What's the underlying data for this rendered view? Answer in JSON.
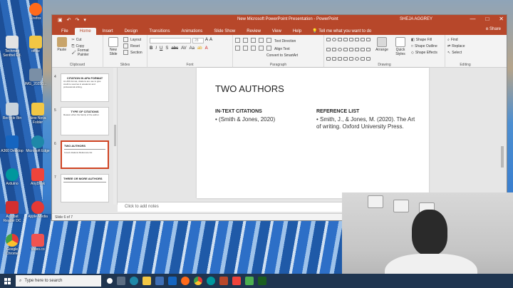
{
  "desktop_icons": [
    {
      "label": "Firefox",
      "color": "#ff6a1a"
    },
    {
      "label": "Techmen Senthel Ed.",
      "color": "#e3e3e3"
    },
    {
      "label": "office",
      "color": "#f2c744"
    },
    {
      "label": "IMG_20250...",
      "color": "#7a8fa6"
    },
    {
      "label": "IMG_20250...",
      "color": "#55677d"
    },
    {
      "label": "Recycle Bin",
      "color": "#c9d3dc"
    },
    {
      "label": "New Nova Folder",
      "color": "#f2c744"
    },
    {
      "label": "A360 Desktop",
      "color": "#1565c0"
    },
    {
      "label": "Microsoft Edge",
      "color": "#1e88a8"
    },
    {
      "label": "Arduino",
      "color": "#00979d"
    },
    {
      "label": "AnyDesk",
      "color": "#ef443b"
    },
    {
      "label": "Acrobat Reader DC",
      "color": "#d32f2f"
    },
    {
      "label": "Apple Media",
      "color": "#e53935"
    },
    {
      "label": "Google Chrome",
      "color": "#4caf50"
    },
    {
      "label": "Video.co",
      "color": "#ef5350"
    }
  ],
  "window": {
    "title": "New Microsoft PowerPoint Presentation - PowerPoint",
    "user": "SHEJA AGGREY",
    "minimize": "—",
    "maximize": "□",
    "close": "✕"
  },
  "ribbon_tabs": [
    "File",
    "Home",
    "Insert",
    "Design",
    "Transitions",
    "Animations",
    "Slide Show",
    "Review",
    "View",
    "Help"
  ],
  "tell_me": "Tell me what you want to do",
  "share": "Share",
  "ribbon": {
    "clipboard": {
      "paste": "Paste",
      "cut": "Cut",
      "copy": "Copy",
      "format_painter": "Format Painter",
      "label": "Clipboard"
    },
    "slides": {
      "new_slide": "New Slide",
      "layout": "Layout",
      "reset": "Reset",
      "section": "Section",
      "label": "Slides"
    },
    "font": {
      "name": "",
      "size": "28",
      "label": "Font"
    },
    "paragraph": {
      "text_direction": "Text Direction",
      "align_text": "Align Text",
      "convert": "Convert to SmartArt",
      "label": "Paragraph"
    },
    "drawing": {
      "arrange": "Arrange",
      "quick_styles": "Quick Styles",
      "shape_fill": "Shape Fill",
      "shape_outline": "Shape Outline",
      "shape_effects": "Shape Effects",
      "label": "Drawing"
    },
    "editing": {
      "find": "Find",
      "replace": "Replace",
      "select": "Select",
      "label": "Editing"
    }
  },
  "thumbnails": [
    {
      "num": "4",
      "title": "CITATION IN APA FORMAT",
      "body": "An APA format, citations are use to give credit to sources in academic and professional writing."
    },
    {
      "num": "5",
      "title": "TYPE OF CITATIONS",
      "body": "Reason when the family of the author."
    },
    {
      "num": "6",
      "title": "TWO AUTHORS",
      "body": "In-text citations  Reference list"
    },
    {
      "num": "7",
      "title": "THREE OR MORE AUTHORS",
      "body": ""
    }
  ],
  "slide": {
    "title": "TWO AUTHORS",
    "col1_heading": "IN-TEXT CITATIONS",
    "col1_item": "• (Smith & Jones, 2020)",
    "col2_heading": "REFERENCE LIST",
    "col2_item": "• Smith, J., & Jones, M. (2020). The Art of writing. Oxford University Press."
  },
  "notes_placeholder": "Click to add notes",
  "status": "Slide 6 of 7",
  "taskbar": {
    "search_placeholder": "Type here to search"
  }
}
